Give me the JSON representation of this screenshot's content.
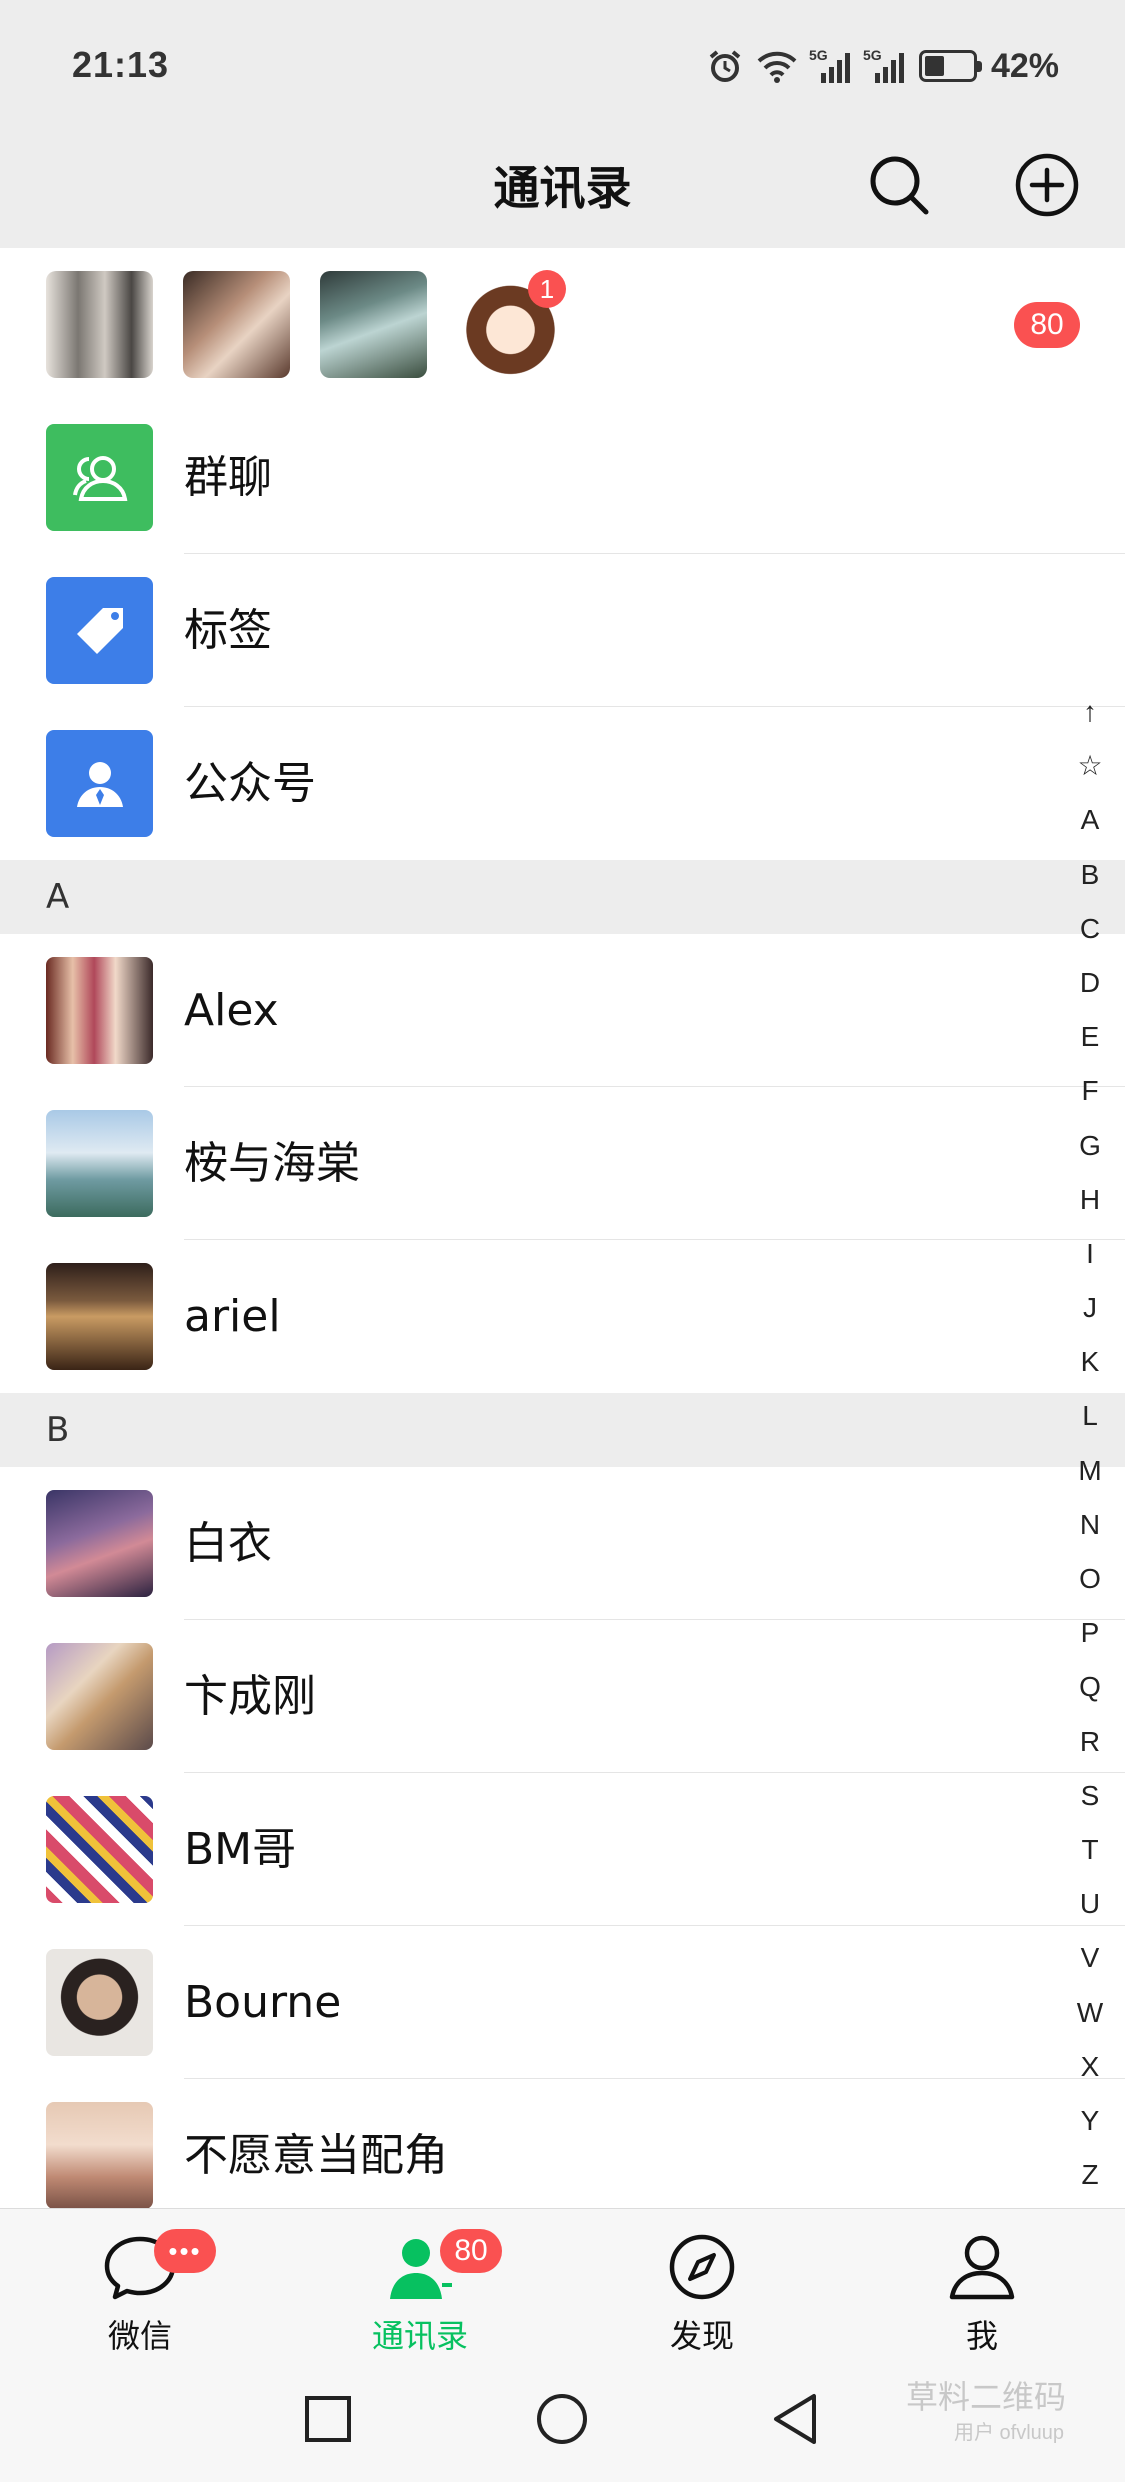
{
  "status_bar": {
    "time": "21:13",
    "battery_percent": "42%",
    "battery_level": 0.42,
    "signal_labels": [
      "5G",
      "5G"
    ],
    "icons": [
      "alarm-icon",
      "wifi-icon",
      "signal-icon",
      "signal-icon",
      "battery-icon"
    ]
  },
  "header": {
    "title": "通讯录",
    "icons": [
      "search-icon",
      "add-circle-icon"
    ]
  },
  "new_friends": {
    "count": "80",
    "avatar_badge": "1"
  },
  "functions": [
    {
      "label": "群聊",
      "icon": "group-chat-icon",
      "color": "#3ebd5f"
    },
    {
      "label": "标签",
      "icon": "tag-icon",
      "color": "#3d7ee8"
    },
    {
      "label": "公众号",
      "icon": "official-account-icon",
      "color": "#3d7ee8"
    }
  ],
  "sections": [
    {
      "letter": "A",
      "contacts": [
        {
          "name": "Alex"
        },
        {
          "name": "桉与海棠"
        },
        {
          "name": "ariel"
        }
      ]
    },
    {
      "letter": "B",
      "contacts": [
        {
          "name": "白衣"
        },
        {
          "name": "卞成刚"
        },
        {
          "name": "BM哥"
        },
        {
          "name": "Bourne"
        },
        {
          "name": "不愿意当配角"
        }
      ]
    }
  ],
  "index_bar": [
    "↑",
    "☆",
    "A",
    "B",
    "C",
    "D",
    "E",
    "F",
    "G",
    "H",
    "I",
    "J",
    "K",
    "L",
    "M",
    "N",
    "O",
    "P",
    "Q",
    "R",
    "S",
    "T",
    "U",
    "V",
    "W",
    "X",
    "Y",
    "Z",
    "#"
  ],
  "tabs": [
    {
      "label": "微信",
      "icon": "chat-bubble-icon",
      "badge": "•••",
      "active": false
    },
    {
      "label": "通讯录",
      "icon": "contacts-icon",
      "badge": "80",
      "active": true
    },
    {
      "label": "发现",
      "icon": "compass-icon",
      "badge": "",
      "active": false
    },
    {
      "label": "我",
      "icon": "person-icon",
      "badge": "",
      "active": false
    }
  ],
  "nav": [
    "recent-apps-icon",
    "home-icon",
    "back-icon"
  ],
  "watermark": {
    "text": "草料二维码",
    "sub": "用户 ofvluup"
  },
  "colors": {
    "accent_green": "#07c160",
    "badge_red": "#fa5151",
    "header_bg": "#ededed"
  }
}
